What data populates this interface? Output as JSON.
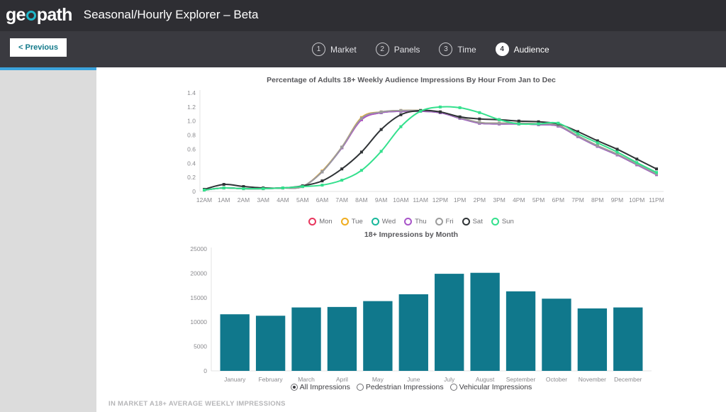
{
  "header": {
    "logo_text_left": "ge",
    "logo_text_right": "path",
    "logo_icon": "circle-o-icon",
    "title": "Seasonal/Hourly Explorer – Beta",
    "brand_accent": "#1fb6c9",
    "background": "#2e2e33"
  },
  "stepbar": {
    "previous_label": "< Previous",
    "background": "#3a3a40",
    "steps": [
      {
        "number": "1",
        "label": "Market",
        "active": false
      },
      {
        "number": "2",
        "label": "Panels",
        "active": false
      },
      {
        "number": "3",
        "label": "Time",
        "active": false
      },
      {
        "number": "4",
        "label": "Audience",
        "active": true
      }
    ]
  },
  "sidebar": {
    "background": "#dcdcdc",
    "progress_color": "#3ba3dd"
  },
  "footer": {
    "note": "IN MARKET A18+ AVERAGE WEEKLY IMPRESSIONS"
  },
  "radio_group": {
    "options": [
      {
        "label": "All Impressions",
        "checked": true
      },
      {
        "label": "Pedestrian Impressions",
        "checked": false
      },
      {
        "label": "Vehicular Impressions",
        "checked": false
      }
    ]
  },
  "chart_data": [
    {
      "type": "line",
      "title": "Percentage of Adults 18+ Weekly Audience Impressions By Hour From Jan to Dec",
      "xlabel": "",
      "ylabel": "",
      "ylim": [
        0,
        1.4
      ],
      "yticks": [
        0,
        0.2,
        0.4,
        0.6,
        0.8,
        1.0,
        1.2,
        1.4
      ],
      "ytick_labels": [
        "0",
        "0.2",
        "0.4",
        "0.6",
        "0.8",
        "1.0",
        "1.2",
        "1.4"
      ],
      "grid": false,
      "legend_position": "bottom",
      "categories": [
        "12AM",
        "1AM",
        "2AM",
        "3AM",
        "4AM",
        "5AM",
        "6AM",
        "7AM",
        "8AM",
        "9AM",
        "10AM",
        "11AM",
        "12PM",
        "1PM",
        "2PM",
        "3PM",
        "4PM",
        "5PM",
        "6PM",
        "7PM",
        "8PM",
        "9PM",
        "10PM",
        "11PM"
      ],
      "series": [
        {
          "name": "Mon",
          "color": "#e8365d",
          "values": [
            0.02,
            0.05,
            0.04,
            0.04,
            0.05,
            0.07,
            0.28,
            0.62,
            1.02,
            1.12,
            1.14,
            1.14,
            1.12,
            1.04,
            0.97,
            0.96,
            0.96,
            0.95,
            0.93,
            0.78,
            0.64,
            0.52,
            0.38,
            0.24
          ]
        },
        {
          "name": "Tue",
          "color": "#f0ad1f",
          "values": [
            0.02,
            0.05,
            0.04,
            0.04,
            0.05,
            0.07,
            0.29,
            0.63,
            1.05,
            1.13,
            1.15,
            1.15,
            1.13,
            1.05,
            0.98,
            0.97,
            0.97,
            0.96,
            0.94,
            0.79,
            0.65,
            0.53,
            0.39,
            0.25
          ]
        },
        {
          "name": "Wed",
          "color": "#19b89b",
          "values": [
            0.02,
            0.05,
            0.04,
            0.04,
            0.05,
            0.07,
            0.28,
            0.62,
            1.03,
            1.12,
            1.14,
            1.14,
            1.12,
            1.04,
            0.97,
            0.96,
            0.96,
            0.95,
            0.93,
            0.78,
            0.64,
            0.52,
            0.38,
            0.24
          ]
        },
        {
          "name": "Thu",
          "color": "#a855c9",
          "values": [
            0.02,
            0.05,
            0.04,
            0.04,
            0.05,
            0.07,
            0.28,
            0.62,
            1.02,
            1.12,
            1.14,
            1.14,
            1.12,
            1.04,
            0.97,
            0.96,
            0.96,
            0.95,
            0.93,
            0.78,
            0.64,
            0.52,
            0.38,
            0.24
          ]
        },
        {
          "name": "Fri",
          "color": "#9c9c9c",
          "values": [
            0.02,
            0.05,
            0.04,
            0.04,
            0.05,
            0.07,
            0.28,
            0.63,
            1.04,
            1.13,
            1.15,
            1.15,
            1.13,
            1.05,
            0.98,
            0.97,
            0.97,
            0.96,
            0.94,
            0.79,
            0.65,
            0.53,
            0.39,
            0.25
          ]
        },
        {
          "name": "Sat",
          "color": "#2f3336",
          "values": [
            0.03,
            0.1,
            0.07,
            0.05,
            0.05,
            0.08,
            0.15,
            0.32,
            0.56,
            0.88,
            1.09,
            1.15,
            1.13,
            1.06,
            1.03,
            1.02,
            1.0,
            0.99,
            0.96,
            0.85,
            0.72,
            0.6,
            0.46,
            0.32
          ]
        },
        {
          "name": "Sun",
          "color": "#34e08d",
          "values": [
            0.02,
            0.05,
            0.04,
            0.04,
            0.05,
            0.07,
            0.09,
            0.16,
            0.3,
            0.57,
            0.92,
            1.14,
            1.2,
            1.19,
            1.12,
            1.02,
            0.96,
            0.96,
            0.97,
            0.82,
            0.69,
            0.56,
            0.41,
            0.27
          ]
        }
      ]
    },
    {
      "type": "bar",
      "title": "18+ Impressions by Month",
      "xlabel": "",
      "ylabel": "",
      "ylim": [
        0,
        25000
      ],
      "yticks": [
        0,
        5000,
        10000,
        15000,
        20000,
        25000
      ],
      "ytick_labels": [
        "0",
        "5000",
        "10000",
        "15000",
        "20000",
        "25000"
      ],
      "grid": false,
      "bar_color": "#10788c",
      "categories": [
        "January",
        "February",
        "March",
        "April",
        "May",
        "June",
        "July",
        "August",
        "September",
        "October",
        "November",
        "December"
      ],
      "values": [
        11600,
        11300,
        13000,
        13100,
        14300,
        15700,
        19900,
        20100,
        16300,
        14800,
        12800,
        13000
      ]
    }
  ]
}
